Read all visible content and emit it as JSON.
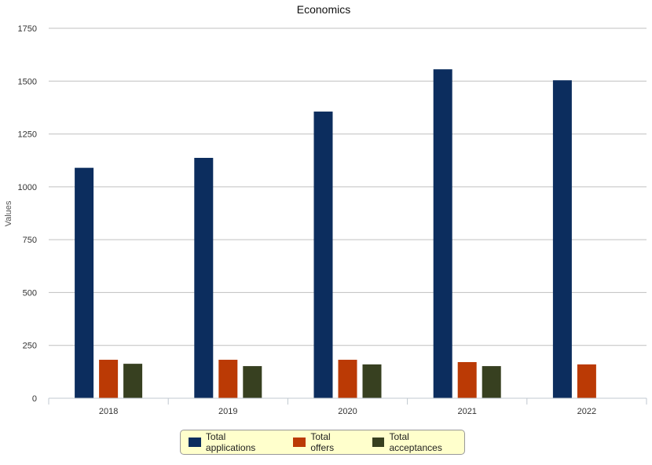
{
  "chart_data": {
    "type": "bar",
    "title": "Economics",
    "xlabel": "",
    "ylabel": "Values",
    "ylim": [
      0,
      1750
    ],
    "yticks": [
      0,
      250,
      500,
      750,
      1000,
      1250,
      1500,
      1750
    ],
    "grid": true,
    "legend_position": "bottom-center",
    "categories": [
      "2018",
      "2019",
      "2020",
      "2021",
      "2022"
    ],
    "series": [
      {
        "name": "Total applications",
        "color": "#0c2d5e",
        "values": [
          1090,
          1137,
          1356,
          1556,
          1504
        ]
      },
      {
        "name": "Total offers",
        "color": "#bb3a05",
        "values": [
          182,
          182,
          182,
          171,
          160
        ]
      },
      {
        "name": "Total acceptances",
        "color": "#374020",
        "values": [
          163,
          152,
          160,
          152,
          null
        ]
      }
    ]
  }
}
